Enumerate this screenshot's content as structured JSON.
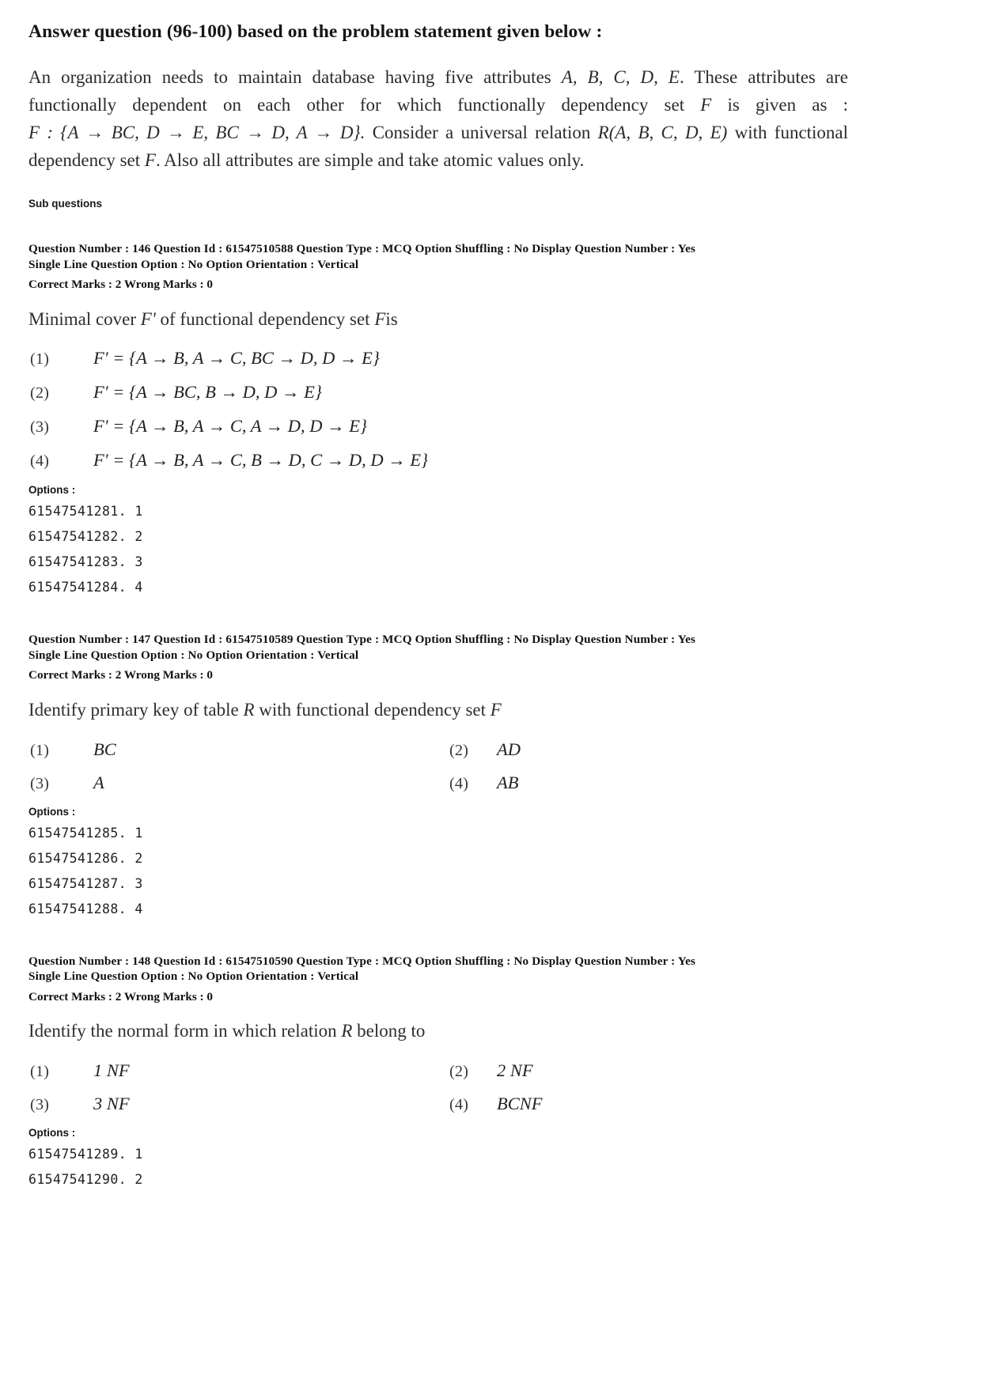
{
  "header": {
    "instruction": "Answer question (96-100) based on the problem statement given below :"
  },
  "problem_statement": {
    "text": "An organization needs to maintain database having five attributes A, B, C, D, E . These attributes are functionally dependent on each other for which functionally dependency set F is given as : F : {A → BC, D → E, BC → D, A → D}. Consider a universal relation R(A, B, C, D, E) with functional dependency set F. Also all attributes are simple and take atomic values only.",
    "seg1": "An organization needs to maintain database having five attributes",
    "attrs": "A, B, C, D, E",
    "seg2": ". These attributes are functionally dependent on each other for which functionally dependency set",
    "fvar": "F",
    "seg3": "is given as :",
    "fdset": "F : {A → BC, D → E, BC → D, A → D}.",
    "seg4": "Consider a universal relation",
    "relation": "R(A, B, C, D, E)",
    "seg5": "with functional dependency set",
    "fvar2": "F",
    "seg6": ". Also all attributes are simple and take atomic values only."
  },
  "sub_questions_label": "Sub questions",
  "questions": [
    {
      "meta_line1": "Question Number : 146  Question Id : 61547510588  Question Type : MCQ  Option Shuffling : No  Display Question Number : Yes",
      "meta_line2": "Single Line Question Option : No  Option Orientation : Vertical",
      "marks_line": "Correct Marks : 2  Wrong Marks : 0",
      "question_number": "146",
      "question_id": "61547510588",
      "question_type": "MCQ",
      "option_shuffling": "No",
      "display_question_number": "Yes",
      "single_line_question_option": "No",
      "option_orientation": "Vertical",
      "correct_marks": "2",
      "wrong_marks": "0",
      "text_pre": "Minimal cover",
      "text_var": "F'",
      "text_post": "of functional dependency set",
      "text_var2": "F",
      "text_end": "is",
      "layout": "vertical",
      "choices": [
        {
          "num": "(1)",
          "body": "F′ = {A → B, A → C, BC → D, D → E}"
        },
        {
          "num": "(2)",
          "body": "F′ = {A → BC, B → D, D → E}"
        },
        {
          "num": "(3)",
          "body": "F′ = {A → B, A → C, A → D, D → E}"
        },
        {
          "num": "(4)",
          "body": "F′ = {A → B, A → C, B → D, C → D, D → E}"
        }
      ],
      "options_label": "Options :",
      "option_ids": [
        "61547541281. 1",
        "61547541282. 2",
        "61547541283. 3",
        "61547541284. 4"
      ]
    },
    {
      "meta_line1": "Question Number : 147  Question Id : 61547510589  Question Type : MCQ  Option Shuffling : No  Display Question Number : Yes",
      "meta_line2": "Single Line Question Option : No  Option Orientation : Vertical",
      "marks_line": "Correct Marks : 2  Wrong Marks : 0",
      "question_number": "147",
      "question_id": "61547510589",
      "question_type": "MCQ",
      "option_shuffling": "No",
      "display_question_number": "Yes",
      "single_line_question_option": "No",
      "option_orientation": "Vertical",
      "correct_marks": "2",
      "wrong_marks": "0",
      "text_pre": "Identify primary key of table",
      "text_var": "R",
      "text_post": "with functional dependency set",
      "text_var2": "F",
      "text_end": "",
      "layout": "two-column",
      "choices": [
        {
          "num": "(1)",
          "body": "BC"
        },
        {
          "num": "(2)",
          "body": "AD"
        },
        {
          "num": "(3)",
          "body": "A"
        },
        {
          "num": "(4)",
          "body": "AB"
        }
      ],
      "options_label": "Options :",
      "option_ids": [
        "61547541285. 1",
        "61547541286. 2",
        "61547541287. 3",
        "61547541288. 4"
      ]
    },
    {
      "meta_line1": "Question Number : 148  Question Id : 61547510590  Question Type : MCQ  Option Shuffling : No  Display Question Number : Yes",
      "meta_line2": "Single Line Question Option : No  Option Orientation : Vertical",
      "marks_line": "Correct Marks : 2  Wrong Marks : 0",
      "question_number": "148",
      "question_id": "61547510590",
      "question_type": "MCQ",
      "option_shuffling": "No",
      "display_question_number": "Yes",
      "single_line_question_option": "No",
      "option_orientation": "Vertical",
      "correct_marks": "2",
      "wrong_marks": "0",
      "text_pre": "Identify the normal form in which relation",
      "text_var": "R",
      "text_post": "belong to",
      "text_var2": "",
      "text_end": "",
      "layout": "two-column",
      "choices": [
        {
          "num": "(1)",
          "body": "1 NF"
        },
        {
          "num": "(2)",
          "body": "2 NF"
        },
        {
          "num": "(3)",
          "body": "3 NF"
        },
        {
          "num": "(4)",
          "body": "BCNF"
        }
      ],
      "options_label": "Options :",
      "option_ids": [
        "61547541289. 1",
        "61547541290. 2"
      ]
    }
  ]
}
